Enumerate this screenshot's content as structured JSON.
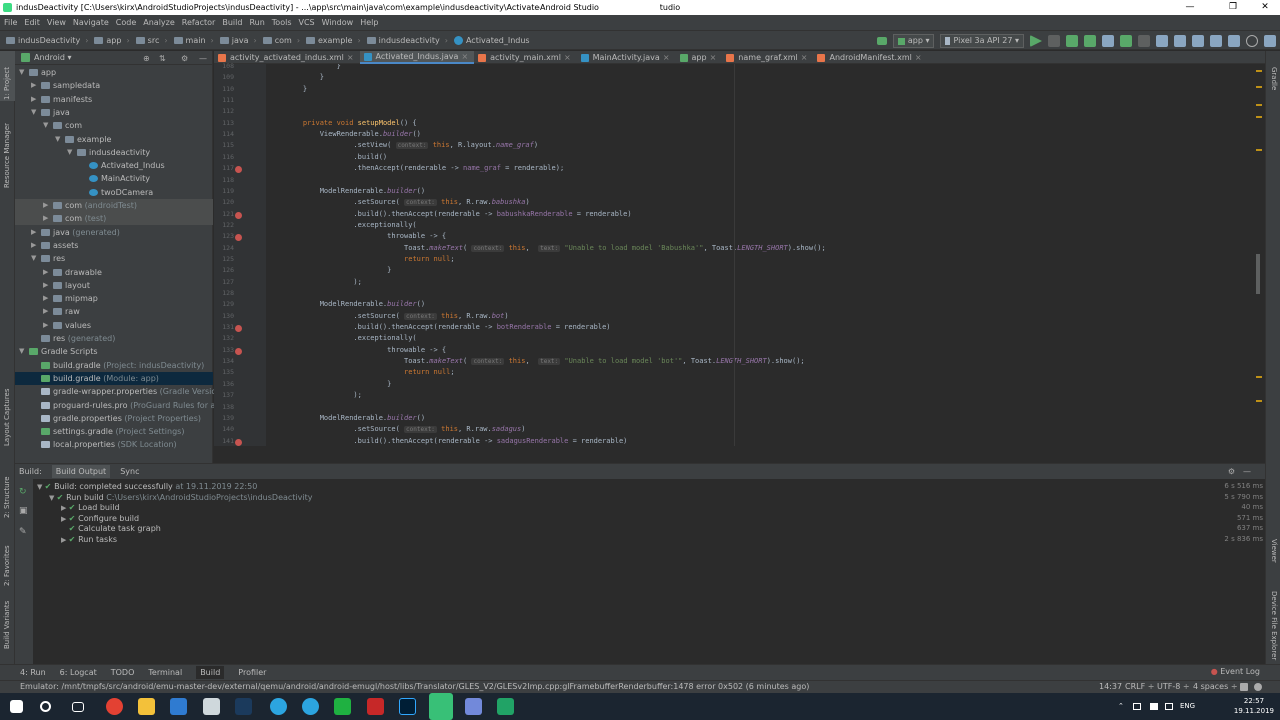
{
  "window": {
    "title": "indusDeactivity [C:\\Users\\kirx\\AndroidStudioProjects\\indusDeactivity] - ...\\app\\src\\main\\java\\com\\example\\indusdeactivity\\Activated_Indus.java [app] - Android Studio",
    "app_name": "Android Studio",
    "minimize": "—",
    "maximize": "❐",
    "close": "✕"
  },
  "menu": [
    "File",
    "Edit",
    "View",
    "Navigate",
    "Code",
    "Analyze",
    "Refactor",
    "Build",
    "Run",
    "Tools",
    "VCS",
    "Window",
    "Help"
  ],
  "breadcrumb": [
    "indusDeactivity",
    "app",
    "src",
    "main",
    "java",
    "com",
    "example",
    "indusdeactivity",
    "Activated_Indus"
  ],
  "toolbar": {
    "config": "app",
    "device": "Pixel 3a API 27"
  },
  "project_panel": {
    "view_label": "Android"
  },
  "tree": [
    {
      "label": "app",
      "suffix": "",
      "indent": 0,
      "arrow": "▼",
      "icon": "#7c8b99"
    },
    {
      "label": "sampledata",
      "suffix": "",
      "indent": 1,
      "arrow": "▶",
      "icon": "#7c8b99"
    },
    {
      "label": "manifests",
      "suffix": "",
      "indent": 1,
      "arrow": "▶",
      "icon": "#7c8b99"
    },
    {
      "label": "java",
      "suffix": "",
      "indent": 1,
      "arrow": "▼",
      "icon": "#7c8b99"
    },
    {
      "label": "com",
      "suffix": "",
      "indent": 2,
      "arrow": "▼",
      "icon": "#7c8b99"
    },
    {
      "label": "example",
      "suffix": "",
      "indent": 3,
      "arrow": "▼",
      "icon": "#7c8b99"
    },
    {
      "label": "indusdeactivity",
      "suffix": "",
      "indent": 4,
      "arrow": "▼",
      "icon": "#7c8b99"
    },
    {
      "label": "Activated_Indus",
      "suffix": "",
      "indent": 5,
      "arrow": "",
      "icon": "#3592c4"
    },
    {
      "label": "MainActivity",
      "suffix": "",
      "indent": 5,
      "arrow": "",
      "icon": "#3592c4"
    },
    {
      "label": "twoDCamera",
      "suffix": "",
      "indent": 5,
      "arrow": "",
      "icon": "#3592c4"
    },
    {
      "label": "com",
      "suffix": " (androidTest)",
      "indent": 2,
      "arrow": "▶",
      "icon": "#7c8b99"
    },
    {
      "label": "com",
      "suffix": " (test)",
      "indent": 2,
      "arrow": "▶",
      "icon": "#7c8b99"
    },
    {
      "label": "java",
      "suffix": " (generated)",
      "indent": 1,
      "arrow": "▶",
      "icon": "#7c8b99"
    },
    {
      "label": "assets",
      "suffix": "",
      "indent": 1,
      "arrow": "▶",
      "icon": "#7c8b99"
    },
    {
      "label": "res",
      "suffix": "",
      "indent": 1,
      "arrow": "▼",
      "icon": "#7c8b99"
    },
    {
      "label": "drawable",
      "suffix": "",
      "indent": 2,
      "arrow": "▶",
      "icon": "#7c8b99"
    },
    {
      "label": "layout",
      "suffix": "",
      "indent": 2,
      "arrow": "▶",
      "icon": "#7c8b99"
    },
    {
      "label": "mipmap",
      "suffix": "",
      "indent": 2,
      "arrow": "▶",
      "icon": "#7c8b99"
    },
    {
      "label": "raw",
      "suffix": "",
      "indent": 2,
      "arrow": "▶",
      "icon": "#7c8b99"
    },
    {
      "label": "values",
      "suffix": "",
      "indent": 2,
      "arrow": "▶",
      "icon": "#7c8b99"
    },
    {
      "label": "res",
      "suffix": " (generated)",
      "indent": 1,
      "arrow": "",
      "icon": "#7c8b99"
    },
    {
      "label": "Gradle Scripts",
      "suffix": "",
      "indent": 0,
      "arrow": "▼",
      "icon": "#59a869"
    },
    {
      "label": "build.gradle",
      "suffix": " (Project: indusDeactivity)",
      "indent": 1,
      "arrow": "",
      "icon": "#59a869"
    },
    {
      "label": "build.gradle",
      "suffix": " (Module: app)",
      "indent": 1,
      "arrow": "",
      "icon": "#59a869"
    },
    {
      "label": "gradle-wrapper.properties",
      "suffix": " (Gradle Version)",
      "indent": 1,
      "arrow": "",
      "icon": "#a9b7c6"
    },
    {
      "label": "proguard-rules.pro",
      "suffix": " (ProGuard Rules for app)",
      "indent": 1,
      "arrow": "",
      "icon": "#a9b7c6"
    },
    {
      "label": "gradle.properties",
      "suffix": " (Project Properties)",
      "indent": 1,
      "arrow": "",
      "icon": "#a9b7c6"
    },
    {
      "label": "settings.gradle",
      "suffix": " (Project Settings)",
      "indent": 1,
      "arrow": "",
      "icon": "#59a869"
    },
    {
      "label": "local.properties",
      "suffix": " (SDK Location)",
      "indent": 1,
      "arrow": "",
      "icon": "#a9b7c6"
    }
  ],
  "tabs": [
    {
      "label": "activity_activated_indus.xml",
      "color": "#e8754a",
      "active": false
    },
    {
      "label": "Activated_Indus.java",
      "color": "#3592c4",
      "active": true
    },
    {
      "label": "activity_main.xml",
      "color": "#e8754a",
      "active": false
    },
    {
      "label": "MainActivity.java",
      "color": "#3592c4",
      "active": false
    },
    {
      "label": "app",
      "color": "#59a869",
      "active": false
    },
    {
      "label": "name_graf.xml",
      "color": "#e8754a",
      "active": false
    },
    {
      "label": "AndroidManifest.xml",
      "color": "#e8754a",
      "active": false
    }
  ],
  "code_lines": [
    {
      "n": "108",
      "bp": false,
      "h": "            }"
    },
    {
      "n": "109",
      "bp": false,
      "h": "        }"
    },
    {
      "n": "110",
      "bp": false,
      "h": "    }"
    },
    {
      "n": "111",
      "bp": false,
      "h": ""
    },
    {
      "n": "112",
      "bp": false,
      "h": ""
    },
    {
      "n": "113",
      "bp": false,
      "h": "    <span class='kw'>private void</span> <span class='fn'>setupModel</span>() {"
    },
    {
      "n": "114",
      "bp": false,
      "h": "        ViewRenderable.<span class='it'>builder</span>()"
    },
    {
      "n": "115",
      "bp": false,
      "h": "                .setView( <span class='hint'>context:</span> <span class='kw'>this</span>, R.layout.<span class='it'>name_graf</span>)"
    },
    {
      "n": "116",
      "bp": false,
      "h": "                .build()"
    },
    {
      "n": "117",
      "bp": true,
      "h": "                .thenAccept(renderable -&gt; <span class='fld'>name_graf</span> = renderable);"
    },
    {
      "n": "118",
      "bp": false,
      "h": ""
    },
    {
      "n": "119",
      "bp": false,
      "h": "        ModelRenderable.<span class='it'>builder</span>()"
    },
    {
      "n": "120",
      "bp": false,
      "h": "                .setSource( <span class='hint'>context:</span> <span class='kw'>this</span>, R.raw.<span class='it'>babushka</span>)"
    },
    {
      "n": "121",
      "bp": true,
      "h": "                .build().thenAccept(renderable -&gt; <span class='fld'>babushkaRenderable</span> = renderable)"
    },
    {
      "n": "122",
      "bp": false,
      "h": "                .exceptionally("
    },
    {
      "n": "123",
      "bp": true,
      "h": "                        throwable -&gt; {"
    },
    {
      "n": "124",
      "bp": false,
      "h": "                            Toast.<span class='it'>makeText</span>( <span class='hint'>context:</span> <span class='kw'>this</span>,  <span class='hint'>text:</span> <span class='str'>\"Unable to load model 'Babushka'\"</span>, Toast.<span class='it'>LENGTH_SHORT</span>).show();"
    },
    {
      "n": "125",
      "bp": false,
      "h": "                            <span class='kw'>return null</span>;"
    },
    {
      "n": "126",
      "bp": false,
      "h": "                        }"
    },
    {
      "n": "127",
      "bp": false,
      "h": "                );"
    },
    {
      "n": "128",
      "bp": false,
      "h": ""
    },
    {
      "n": "129",
      "bp": false,
      "h": "        ModelRenderable.<span class='it'>builder</span>()"
    },
    {
      "n": "130",
      "bp": false,
      "h": "                .setSource( <span class='hint'>context:</span> <span class='kw'>this</span>, R.raw.<span class='it'>bot</span>)"
    },
    {
      "n": "131",
      "bp": true,
      "h": "                .build().thenAccept(renderable -&gt; <span class='fld'>botRenderable</span> = renderable)"
    },
    {
      "n": "132",
      "bp": false,
      "h": "                .exceptionally("
    },
    {
      "n": "133",
      "bp": true,
      "h": "                        throwable -&gt; {"
    },
    {
      "n": "134",
      "bp": false,
      "h": "                            Toast.<span class='it'>makeText</span>( <span class='hint'>context:</span> <span class='kw'>this</span>,  <span class='hint'>text:</span> <span class='str'>\"Unable to load model 'bot'\"</span>, Toast.<span class='it'>LENGTH_SHORT</span>).show();"
    },
    {
      "n": "135",
      "bp": false,
      "h": "                            <span class='kw'>return null</span>;"
    },
    {
      "n": "136",
      "bp": false,
      "h": "                        }"
    },
    {
      "n": "137",
      "bp": false,
      "h": "                );"
    },
    {
      "n": "138",
      "bp": false,
      "h": ""
    },
    {
      "n": "139",
      "bp": false,
      "h": "        ModelRenderable.<span class='it'>builder</span>()"
    },
    {
      "n": "140",
      "bp": false,
      "h": "                .setSource( <span class='hint'>context:</span> <span class='kw'>this</span>, R.raw.<span class='it'>sadagus</span>)"
    },
    {
      "n": "141",
      "bp": true,
      "h": "                .build().thenAccept(renderable -&gt; <span class='fld'>sadagusRenderable</span> = renderable)"
    }
  ],
  "build": {
    "tabs": [
      "Build:",
      "Build Output",
      "Sync"
    ],
    "rows": [
      {
        "indent": 0,
        "arrow": "▼",
        "text": "Build: completed successfully",
        "suffix": " at 19.11.2019 22:50",
        "time": "6 s 516 ms"
      },
      {
        "indent": 1,
        "arrow": "▼",
        "text": "Run build",
        "suffix": " C:\\Users\\kirx\\AndroidStudioProjects\\indusDeactivity",
        "time": "5 s 790 ms"
      },
      {
        "indent": 2,
        "arrow": "▶",
        "text": "Load build",
        "suffix": "",
        "time": "40 ms"
      },
      {
        "indent": 2,
        "arrow": "▶",
        "text": "Configure build",
        "suffix": "",
        "time": "571 ms"
      },
      {
        "indent": 2,
        "arrow": "",
        "text": "Calculate task graph",
        "suffix": "",
        "time": "637 ms"
      },
      {
        "indent": 2,
        "arrow": "▶",
        "text": "Run tasks",
        "suffix": "",
        "time": "2 s 836 ms"
      }
    ]
  },
  "bottom_tabs": [
    "4: Run",
    "6: Logcat",
    "TODO",
    "Terminal",
    "Build",
    "Profiler"
  ],
  "event_log": "Event Log",
  "status": {
    "message": "Emulator: /mnt/tmpfs/src/android/emu-master-dev/external/qemu/android/android-emugl/host/libs/Translator/GLES_V2/GLESv2Imp.cpp:glFramebufferRenderbuffer:1478 error 0x502 (6 minutes ago)",
    "position": "14:37",
    "line_sep": "CRLF ÷",
    "encoding": "UTF-8 ÷",
    "indent": "4 spaces ÷"
  },
  "side_labels": {
    "left": [
      "1: Project",
      "Resource Manager",
      "Layout Captures",
      "2: Structure",
      "2: Favorites",
      "Build Variants"
    ],
    "right": [
      "Gradle",
      "Viewer",
      "Device File Explorer"
    ]
  },
  "taskbar": {
    "lang": "ENG",
    "time": "22:57",
    "date": "19.11.2019"
  }
}
